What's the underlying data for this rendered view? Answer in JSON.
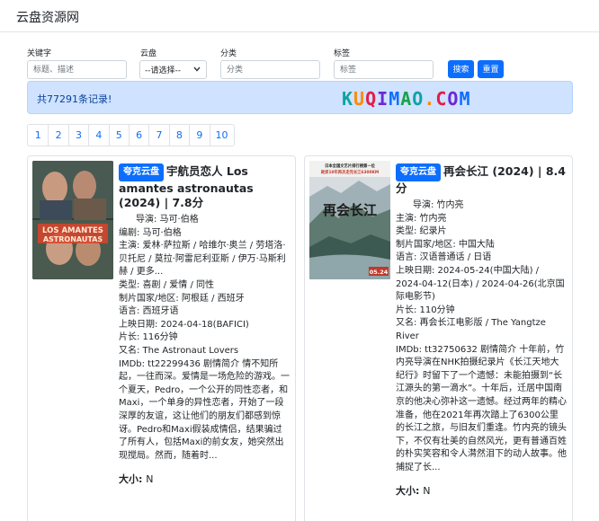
{
  "site": {
    "brand": "云盘资源网"
  },
  "filters": {
    "keyword": {
      "label": "关键字",
      "placeholder": "标题、描述"
    },
    "drive": {
      "label": "云盘",
      "value": "--请选择--"
    },
    "category": {
      "label": "分类",
      "placeholder": "分类"
    },
    "tag": {
      "label": "标签",
      "placeholder": "标签"
    },
    "search_label": "搜索",
    "reset_label": "重置"
  },
  "alert": {
    "text": "共77291条记录!"
  },
  "watermark": {
    "text": "KUQIMAO.COM",
    "colors": [
      "#0fa3a3",
      "#ff8a00",
      "#e11d48",
      "#6d28d9",
      "#0d6efd",
      "#16a34a"
    ]
  },
  "pagination": [
    "1",
    "2",
    "3",
    "4",
    "5",
    "6",
    "7",
    "8",
    "9",
    "10"
  ],
  "cards": [
    {
      "badge": "夸克云盘",
      "title": "宇航员恋人 Los amantes astronautas (2024) | 7.8分",
      "poster_text": "LOS AMANTES ASTRONAUTAS",
      "lines": [
        "导演: 马可·伯格",
        "编剧: 马可·伯格",
        "主演: 爱林·萨拉斯 / 哈维尔·奥兰 / 劳塔洛·贝托尼 / 莫拉·阿雷尼利亚斯 / 伊万·马斯利赫 / 更多...",
        "类型: 喜剧 / 爱情 / 同性",
        "制片国家/地区: 阿根廷 / 西班牙",
        "语言: 西班牙语",
        "上映日期: 2024-04-18(BAFICI)",
        "片长: 116分钟",
        "又名: The Astronaut Lovers",
        "IMDb: tt22299436 剧情简介 情不知所起，一往而深。爱情是一场危险的游戏。一个夏天，Pedro，一个公开的同性恋者，和Maxi，一个单身的异性恋者，开始了一段深厚的友谊，这让他们的朋友们都感到惊讶。Pedro和Maxi假装成情侣，结果骗过了所有人，包括Maxi的前女友，她突然出现搅局。然而，随着时..."
      ],
      "size_label": "大小:",
      "size_value": "N"
    },
    {
      "badge": "夸克云盘",
      "title": "再会长江 (2024) | 8.4分",
      "poster_text": "再会长江",
      "poster_top": "日本全国文艺片排行榜第一位 耗资10年再次走完长江6300KM",
      "poster_date": "05.24",
      "lines": [
        "导演: 竹内亮",
        "主演: 竹内亮",
        "类型: 纪录片",
        "制片国家/地区: 中国大陆",
        "语言: 汉语普通话 / 日语",
        "上映日期: 2024-05-24(中国大陆) / 2024-04-12(日本) / 2024-04-26(北京国际电影节)",
        "片长: 110分钟",
        "又名: 再会长江电影版 / The Yangtze River",
        "IMDb: tt32750632 剧情简介 十年前，竹内亮导演在NHK拍摄纪录片《长江天地大纪行》时留下了一个遗憾：未能拍摄到“长江源头的第一滴水”。十年后，迁居中国南京的他决心弥补这一遗憾。经过两年的精心准备，他在2021年再次踏上了6300公里的长江之旅，与旧友们重逢。竹内亮的镜头下，不仅有壮美的自然风光，更有普通百姓的朴实笑容和令人潸然泪下的动人故事。他捕捉了长..."
      ],
      "size_label": "大小:",
      "size_value": "N"
    }
  ]
}
